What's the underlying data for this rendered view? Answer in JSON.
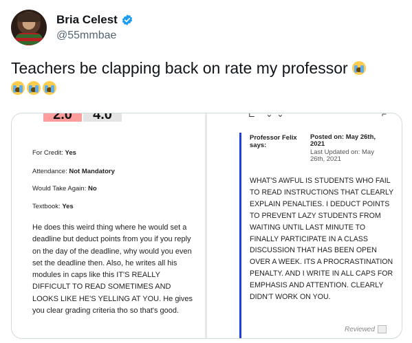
{
  "tweet": {
    "author": {
      "display_name": "Bria Celest",
      "handle": "@55mmbae",
      "verified": true
    },
    "text": "Teachers be clapping back on rate my professor",
    "emoji_icon": "loudly-crying-face-icon",
    "emoji_count": 4
  },
  "screenshot_left": {
    "scores": [
      "2.0",
      "4.0"
    ],
    "score_colors": [
      "#ff9c9c",
      "#e4e4e4"
    ],
    "fields": [
      {
        "label": "For Credit: ",
        "value": "Yes"
      },
      {
        "label": "Attendance: ",
        "value": "Not Mandatory"
      },
      {
        "label": "Would Take Again: ",
        "value": "No"
      },
      {
        "label": "Textbook: ",
        "value": "Yes"
      }
    ],
    "review_text": "He does this weird thing where he would set a deadline but deduct points from you if you reply on the day of the deadline, why would you even set the deadline then. Also, he writes all his modules in caps like this IT'S REALLY DIFFICULT TO READ SOMETIMES AND LOOKS LIKE HE'S YELLING AT YOU. He gives you clear grading criteria tho so that's good."
  },
  "screenshot_right": {
    "professor_label": "Professor Felix says:",
    "posted_on": "Posted on: May 26th, 2021",
    "updated_on": "Last Updated on: May 26th, 2021",
    "reply_text": "WHAT'S AWFUL IS STUDENTS WHO FAIL TO READ INSTRUCTIONS THAT CLEARLY EXPLAIN PENALTIES. I DEDUCT POINTS TO PREVENT LAZY STUDENTS FROM WAITING UNTIL LAST MINUTE TO FINALLY PARTICIPATE IN A CLASS DISCUSSION THAT HAS BEEN OPEN OVER A WEEK. ITS A PROCRASTINATION PENALTY. AND I WRITE IN ALL CAPS FOR EMPHASIS AND ATTENTION. CLEARLY DIDN'T WORK ON YOU.",
    "reviewed_label": "Reviewed",
    "accent_color": "#1f3fd6"
  },
  "colors": {
    "verified_badge": "#1d9bf0",
    "handle": "#536471"
  }
}
